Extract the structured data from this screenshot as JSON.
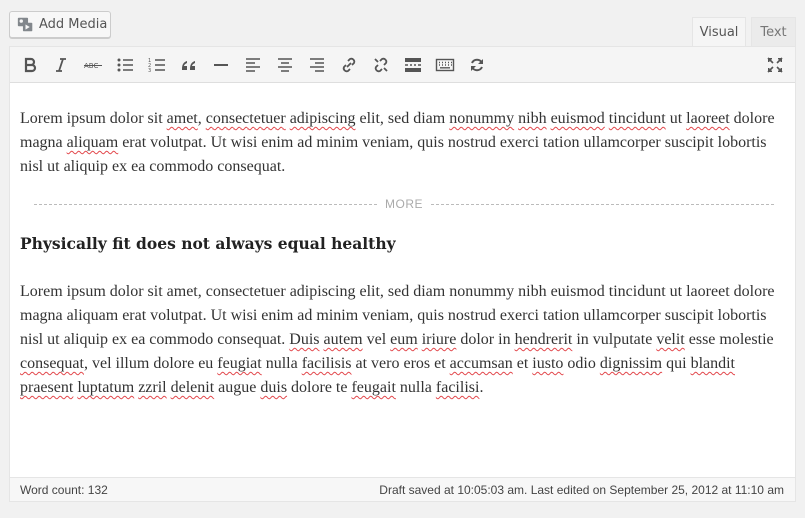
{
  "header": {
    "add_media_label": "Add Media",
    "tabs": [
      "Visual",
      "Text"
    ]
  },
  "toolbar": {
    "buttons": [
      "bold",
      "italic",
      "strikethrough",
      "bulleted-list",
      "numbered-list",
      "blockquote",
      "horizontal-line",
      "align-left",
      "align-center",
      "align-right",
      "insert-link",
      "remove-link",
      "insert-more",
      "toolbar-toggle",
      "refresh",
      "fullscreen"
    ]
  },
  "content": {
    "para1": [
      {
        "t": "Lorem ipsum dolor sit ",
        "s": false
      },
      {
        "t": "amet",
        "s": true
      },
      {
        "t": ", ",
        "s": false
      },
      {
        "t": "consectetuer",
        "s": true
      },
      {
        "t": " ",
        "s": false
      },
      {
        "t": "adipiscing",
        "s": true
      },
      {
        "t": " elit, sed diam ",
        "s": false
      },
      {
        "t": "nonummy",
        "s": true
      },
      {
        "t": " ",
        "s": false
      },
      {
        "t": "nibh",
        "s": true
      },
      {
        "t": " ",
        "s": false
      },
      {
        "t": "euismod",
        "s": true
      },
      {
        "t": " ",
        "s": false
      },
      {
        "t": "tincidunt",
        "s": true
      },
      {
        "t": " ut ",
        "s": false
      },
      {
        "t": "laoreet",
        "s": true
      },
      {
        "t": " dolore magna ",
        "s": false
      },
      {
        "t": "aliquam",
        "s": true
      },
      {
        "t": " erat volutpat. Ut wisi enim ad minim veniam, quis nostrud exerci tation ullamcorper suscipit lobortis nisl ut aliquip ex ea commodo consequat.",
        "s": false
      }
    ],
    "more_label": "MORE",
    "heading": "Physically fit does not always equal healthy",
    "para2": [
      {
        "t": "Lorem ipsum dolor sit amet, consectetuer adipiscing elit, sed diam nonummy nibh euismod tincidunt ut laoreet dolore magna aliquam erat volutpat. Ut wisi enim ad minim veniam, quis nostrud exerci tation ullamcorper suscipit lobortis nisl ut aliquip ex ea commodo consequat. ",
        "s": false
      },
      {
        "t": "Duis",
        "s": true
      },
      {
        "t": " ",
        "s": false
      },
      {
        "t": "autem",
        "s": true
      },
      {
        "t": " vel ",
        "s": false
      },
      {
        "t": "eum",
        "s": true
      },
      {
        "t": " ",
        "s": false
      },
      {
        "t": "iriure",
        "s": true
      },
      {
        "t": " dolor in ",
        "s": false
      },
      {
        "t": "hendrerit",
        "s": true
      },
      {
        "t": " in vulputate ",
        "s": false
      },
      {
        "t": "velit",
        "s": true
      },
      {
        "t": " esse molestie ",
        "s": false
      },
      {
        "t": "consequat",
        "s": true
      },
      {
        "t": ", vel illum dolore eu ",
        "s": false
      },
      {
        "t": "feugiat",
        "s": true
      },
      {
        "t": " nulla ",
        "s": false
      },
      {
        "t": "facilisis",
        "s": true
      },
      {
        "t": " at vero eros et ",
        "s": false
      },
      {
        "t": "accumsan",
        "s": true
      },
      {
        "t": " et ",
        "s": false
      },
      {
        "t": "iusto",
        "s": true
      },
      {
        "t": " odio ",
        "s": false
      },
      {
        "t": "dignissim",
        "s": true
      },
      {
        "t": " qui ",
        "s": false
      },
      {
        "t": "blandit",
        "s": true
      },
      {
        "t": " ",
        "s": false
      },
      {
        "t": "praesent",
        "s": true
      },
      {
        "t": " ",
        "s": false
      },
      {
        "t": "luptatum",
        "s": true
      },
      {
        "t": " ",
        "s": false
      },
      {
        "t": "zzril",
        "s": true
      },
      {
        "t": " ",
        "s": false
      },
      {
        "t": "delenit",
        "s": true
      },
      {
        "t": " augue ",
        "s": false
      },
      {
        "t": "duis",
        "s": true
      },
      {
        "t": " dolore te ",
        "s": false
      },
      {
        "t": "feugait",
        "s": true
      },
      {
        "t": " nulla ",
        "s": false
      },
      {
        "t": "facilisi",
        "s": true
      },
      {
        "t": ".",
        "s": false
      }
    ]
  },
  "status": {
    "word_count": "Word count: 132",
    "draft": "Draft saved at 10:05:03 am. Last edited on September 25, 2012 at 11:10 am"
  },
  "colors": {
    "spellcheck": "#e2474b",
    "toolbar_bg": "#f5f5f5"
  }
}
